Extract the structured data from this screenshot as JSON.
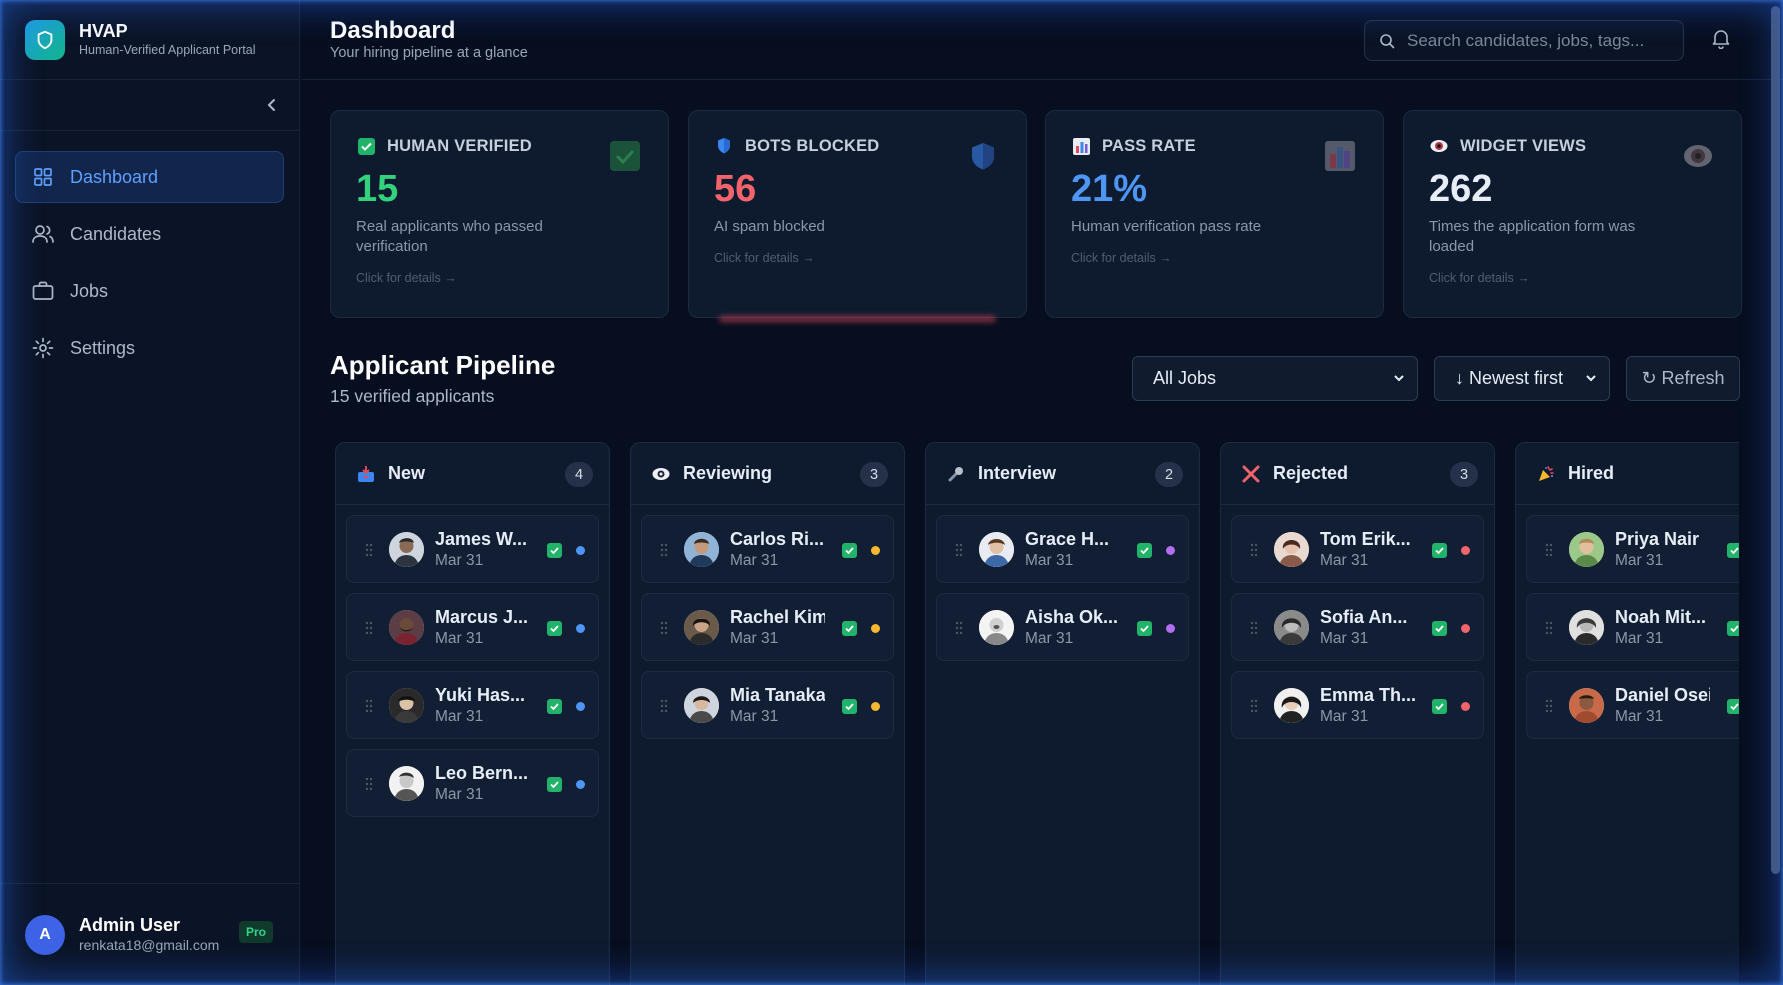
{
  "brand": {
    "name": "HVAP",
    "subtitle": "Human-Verified Applicant Portal"
  },
  "nav": [
    {
      "label": "Dashboard",
      "icon": "grid-icon",
      "active": true
    },
    {
      "label": "Candidates",
      "icon": "users-icon",
      "active": false
    },
    {
      "label": "Jobs",
      "icon": "briefcase-icon",
      "active": false
    },
    {
      "label": "Settings",
      "icon": "gear-icon",
      "active": false
    }
  ],
  "user": {
    "initial": "A",
    "name": "Admin User",
    "email": "renkata18@gmail.com",
    "badge": "Pro"
  },
  "header": {
    "title": "Dashboard",
    "subtitle": "Your hiring pipeline at a glance",
    "search_placeholder": "Search candidates, jobs, tags..."
  },
  "stats": [
    {
      "title": "HUMAN VERIFIED",
      "value": "15",
      "desc": "Real applicants who passed verification",
      "link": "Click for details →",
      "color": "#34d17c",
      "icon": "check-box-icon"
    },
    {
      "title": "BOTS BLOCKED",
      "value": "56",
      "desc": "AI spam blocked",
      "link": "Click for details →",
      "color": "#f2636b",
      "icon": "shield-icon"
    },
    {
      "title": "PASS RATE",
      "value": "21%",
      "desc": "Human verification pass rate",
      "link": "Click for details →",
      "color": "#4e96f5",
      "icon": "bar-chart-icon"
    },
    {
      "title": "WIDGET VIEWS",
      "value": "262",
      "desc": "Times the application form was loaded",
      "link": "Click for details →",
      "color": "#e6edf7",
      "icon": "eye-icon"
    }
  ],
  "pipeline": {
    "title": "Applicant Pipeline",
    "count_text": "15 verified applicants",
    "job_filter": "All Jobs",
    "sort": "↓ Newest first",
    "refresh_label": "↻ Refresh",
    "columns": [
      {
        "name": "New",
        "count": "4",
        "icon": "inbox-icon",
        "dot": "#4e96f5",
        "cards": [
          {
            "name": "James W...",
            "date": "Mar 31"
          },
          {
            "name": "Marcus J...",
            "date": "Mar 31"
          },
          {
            "name": "Yuki Has...",
            "date": "Mar 31"
          },
          {
            "name": "Leo Bern...",
            "date": "Mar 31"
          }
        ]
      },
      {
        "name": "Reviewing",
        "count": "3",
        "icon": "eye-icon",
        "dot": "#f5b82e",
        "cards": [
          {
            "name": "Carlos Ri...",
            "date": "Mar 31"
          },
          {
            "name": "Rachel Kim",
            "date": "Mar 31"
          },
          {
            "name": "Mia Tanaka",
            "date": "Mar 31"
          }
        ]
      },
      {
        "name": "Interview",
        "count": "2",
        "icon": "microphone-icon",
        "dot": "#b36ef0",
        "cards": [
          {
            "name": "Grace H...",
            "date": "Mar 31"
          },
          {
            "name": "Aisha Ok...",
            "date": "Mar 31"
          }
        ]
      },
      {
        "name": "Rejected",
        "count": "3",
        "icon": "cross-icon",
        "dot": "#f2636b",
        "cards": [
          {
            "name": "Tom Erik...",
            "date": "Mar 31"
          },
          {
            "name": "Sofia An...",
            "date": "Mar 31"
          },
          {
            "name": "Emma Th...",
            "date": "Mar 31"
          }
        ]
      },
      {
        "name": "Hired",
        "count": "",
        "icon": "party-icon",
        "dot": "#34d17c",
        "cards": [
          {
            "name": "Priya Nair",
            "date": "Mar 31"
          },
          {
            "name": "Noah Mit...",
            "date": "Mar 31"
          },
          {
            "name": "Daniel Osei",
            "date": "Mar 31"
          }
        ]
      }
    ]
  }
}
